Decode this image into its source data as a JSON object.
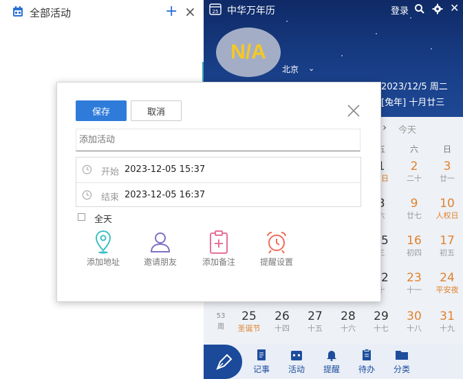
{
  "left_panel": {
    "title": "全部活动",
    "add_icon": "plus-icon",
    "close_icon": "close-icon"
  },
  "app": {
    "title": "中华万年历",
    "calendar_day": "25",
    "login_label": "登录",
    "weather": {
      "value": "N/A"
    },
    "city": "北京",
    "date": "2023/12/5  周二",
    "lunar": "[兔年] 十月廿三",
    "today_label": "今天",
    "week_headers": [
      "五",
      "六",
      "日"
    ],
    "rows": [
      {
        "week": "",
        "cells": [
          {
            "n": "1",
            "s": "病日",
            "we": false,
            "hl": true
          },
          {
            "n": "2",
            "s": "二十",
            "we": true,
            "hl": false
          },
          {
            "n": "3",
            "s": "廿一",
            "we": true,
            "hl": false
          }
        ]
      },
      {
        "week": "",
        "cells": [
          {
            "n": "8",
            "s": "六",
            "we": false,
            "hl": false
          },
          {
            "n": "9",
            "s": "廿七",
            "we": true,
            "hl": false
          },
          {
            "n": "10",
            "s": "人权日",
            "we": true,
            "hl": true
          }
        ]
      },
      {
        "week": "",
        "cells": [
          {
            "n": "15",
            "s": "三",
            "we": false,
            "hl": false
          },
          {
            "n": "16",
            "s": "初四",
            "we": true,
            "hl": false
          },
          {
            "n": "17",
            "s": "初五",
            "we": true,
            "hl": false
          }
        ]
      },
      {
        "week": "",
        "cells": [
          {
            "n": "22",
            "s": "十",
            "we": false,
            "hl": false
          },
          {
            "n": "23",
            "s": "十一",
            "we": true,
            "hl": false
          },
          {
            "n": "24",
            "s": "平安夜",
            "we": true,
            "hl": true
          }
        ]
      }
    ],
    "last_row": {
      "week": "53",
      "week_unit": "周",
      "cells": [
        {
          "n": "25",
          "s": "圣诞节",
          "we": false,
          "hl": true
        },
        {
          "n": "26",
          "s": "十四",
          "we": false,
          "hl": false
        },
        {
          "n": "27",
          "s": "十五",
          "we": false,
          "hl": false
        },
        {
          "n": "28",
          "s": "十六",
          "we": false,
          "hl": false
        },
        {
          "n": "29",
          "s": "十七",
          "we": false,
          "hl": false
        },
        {
          "n": "30",
          "s": "十八",
          "we": true,
          "hl": false
        },
        {
          "n": "31",
          "s": "十九",
          "we": true,
          "hl": false
        }
      ]
    },
    "bottom_tabs": [
      {
        "label": "记事",
        "icon": "note-icon"
      },
      {
        "label": "活动",
        "icon": "calendar-icon"
      },
      {
        "label": "提醒",
        "icon": "bell-icon"
      },
      {
        "label": "待办",
        "icon": "clipboard-icon"
      },
      {
        "label": "分类",
        "icon": "folder-icon"
      }
    ],
    "colors": {
      "header": "#183d86",
      "accent": "#2f7bd9",
      "weekend": "#e0822c"
    }
  },
  "dialog": {
    "save_label": "保存",
    "cancel_label": "取消",
    "activity_placeholder": "添加活动",
    "start_label": "开始",
    "start_value": "2023-12-05 15:37",
    "end_label": "结束",
    "end_value": "2023-12-05 16:37",
    "allday_label": "全天",
    "actions": [
      {
        "label": "添加地址",
        "icon": "location-pin-icon"
      },
      {
        "label": "邀请朋友",
        "icon": "person-icon"
      },
      {
        "label": "添加备注",
        "icon": "add-note-icon"
      },
      {
        "label": "提醒设置",
        "icon": "alarm-clock-icon"
      }
    ]
  }
}
